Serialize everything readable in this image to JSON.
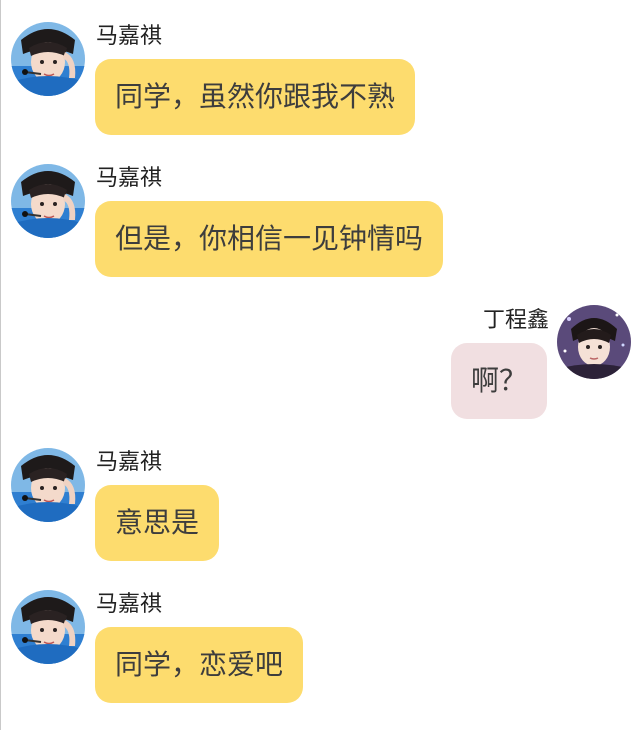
{
  "messages": [
    {
      "sender": "马嘉祺",
      "text": "同学，虽然你跟我不熟",
      "side": "left"
    },
    {
      "sender": "马嘉祺",
      "text": "但是，你相信一见钟情吗",
      "side": "left"
    },
    {
      "sender": "丁程鑫",
      "text": "啊？",
      "side": "right"
    },
    {
      "sender": "马嘉祺",
      "text": "意思是",
      "side": "left"
    },
    {
      "sender": "马嘉祺",
      "text": "同学，恋爱吧",
      "side": "left"
    }
  ],
  "colors": {
    "left_bubble": "#fddc6e",
    "right_bubble": "#f1dfe1",
    "text": "#3d3d3d"
  }
}
